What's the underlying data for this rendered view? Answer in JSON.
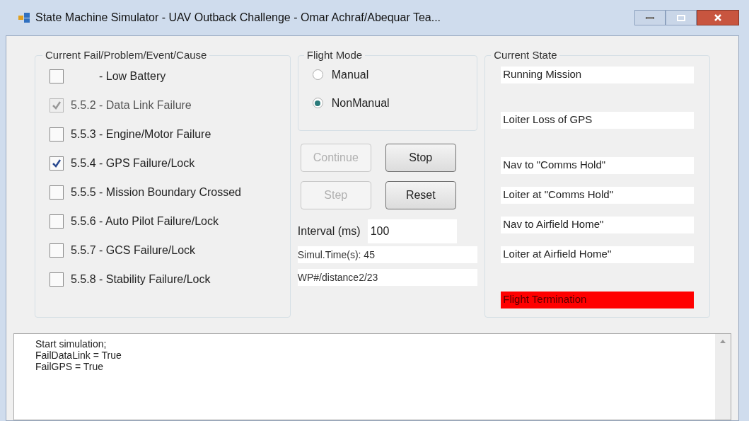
{
  "window": {
    "title": "State Machine Simulator - UAV Outback Challenge - Omar Achraf/Abequar Tea..."
  },
  "fail_group": {
    "title": "Current Fail/Problem/Event/Cause",
    "items": [
      {
        "label": "- Low Battery",
        "checked": false,
        "disabled": false
      },
      {
        "label": "5.5.2 - Data Link Failure",
        "checked": true,
        "disabled": true
      },
      {
        "label": "5.5.3 - Engine/Motor Failure",
        "checked": false,
        "disabled": false
      },
      {
        "label": "5.5.4 - GPS Failure/Lock",
        "checked": true,
        "disabled": false
      },
      {
        "label": "5.5.5 - Mission Boundary Crossed",
        "checked": false,
        "disabled": false
      },
      {
        "label": "5.5.6 - Auto Pilot Failure/Lock",
        "checked": false,
        "disabled": false
      },
      {
        "label": "5.5.7 - GCS Failure/Lock",
        "checked": false,
        "disabled": false
      },
      {
        "label": "5.5.8 - Stability Failure/Lock",
        "checked": false,
        "disabled": false
      }
    ]
  },
  "flight_mode": {
    "title": "Flight Mode",
    "options": [
      {
        "label": "Manual",
        "selected": false
      },
      {
        "label": "NonManual",
        "selected": true
      }
    ]
  },
  "buttons": [
    {
      "label": "Continue",
      "disabled": true
    },
    {
      "label": "Stop",
      "disabled": false
    },
    {
      "label": "Step",
      "disabled": true
    },
    {
      "label": "Reset",
      "disabled": false
    }
  ],
  "interval": {
    "label": "Interval (ms)",
    "value": "100"
  },
  "simul_time": "Simul.Time(s): 45",
  "wp_distance": "WP#/distance2/23",
  "state_group": {
    "title": "Current State",
    "states": [
      {
        "label": "Running Mission",
        "highlighted": false
      },
      {
        "label": "Loiter Loss of GPS",
        "highlighted": false
      },
      {
        "label": "Nav to \"Comms Hold\"",
        "highlighted": false
      },
      {
        "label": "Loiter at \"Comms Hold\"",
        "highlighted": false
      },
      {
        "label": "Nav to Airfield Home\"",
        "highlighted": false
      },
      {
        "label": "Loiter at Airfield Home''",
        "highlighted": false
      },
      {
        "label": "Flight Termination",
        "highlighted": true
      }
    ]
  },
  "log": [
    "Start simulation;",
    "FailDataLink = True",
    "FailGPS = True"
  ]
}
